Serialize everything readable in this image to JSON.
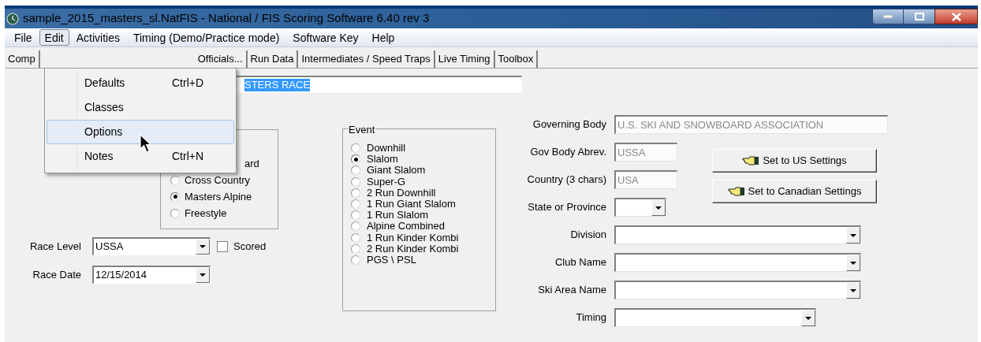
{
  "window": {
    "title": "sample_2015_masters_sl.NatFIS - National / FIS Scoring Software 6.40 rev 3"
  },
  "menu_bar": [
    {
      "label": "File",
      "selected": false
    },
    {
      "label": "Edit",
      "selected": true
    },
    {
      "label": "Activities",
      "selected": false
    },
    {
      "label": "Timing (Demo/Practice mode)",
      "selected": false
    },
    {
      "label": "Software Key",
      "selected": false
    },
    {
      "label": "Help",
      "selected": false
    }
  ],
  "edit_menu": [
    {
      "label": "Defaults",
      "shortcut": "Ctrl+D",
      "selected": false
    },
    {
      "label": "Classes",
      "selected": false
    },
    {
      "label": "Options",
      "selected": true
    },
    {
      "label": "Notes",
      "shortcut": "Ctrl+N",
      "selected": false
    }
  ],
  "tabs": [
    {
      "label": "Comp"
    },
    {
      "label": "Officials..."
    },
    {
      "label": "Run Data"
    },
    {
      "label": "Intermediates / Speed Traps"
    },
    {
      "label": "Live Timing"
    },
    {
      "label": "Toolbox"
    }
  ],
  "race_name": {
    "value": "STERS RACE",
    "text_selected": true
  },
  "discipline_covered_label": "ard",
  "discipline": [
    {
      "label": "Cross Country",
      "selected": false
    },
    {
      "label": "Masters Alpine",
      "selected": true
    },
    {
      "label": "Freestyle",
      "selected": false
    }
  ],
  "race_level": {
    "label": "Race Level",
    "value": "USSA"
  },
  "scored": {
    "label": "Scored",
    "checked": false
  },
  "race_date": {
    "label": "Race Date",
    "value": "12/15/2014"
  },
  "event": {
    "title": "Event",
    "options": [
      {
        "label": "Downhill",
        "selected": false
      },
      {
        "label": "Slalom",
        "selected": true
      },
      {
        "label": "Giant Slalom",
        "selected": false
      },
      {
        "label": "Super-G",
        "selected": false
      },
      {
        "label": "2 Run Downhill",
        "selected": false
      },
      {
        "label": "1 Run Giant Slalom",
        "selected": false
      },
      {
        "label": "1 Run Slalom",
        "selected": false
      },
      {
        "label": "Alpine Combined",
        "selected": false
      },
      {
        "label": "1 Run Kinder Kombi",
        "selected": false
      },
      {
        "label": "2 Run Kinder Kombi",
        "selected": false
      },
      {
        "label": "PGS \\ PSL",
        "selected": false
      }
    ]
  },
  "settings_fields": [
    {
      "label": "Governing Body",
      "kind": "text",
      "value": "U.S. SKI AND SNOWBOARD ASSOCIATION",
      "disabled": true
    },
    {
      "label": "Gov Body Abrev.",
      "kind": "text",
      "value": "USSA",
      "disabled": true
    },
    {
      "label": "Country (3 chars)",
      "kind": "text",
      "value": "USA",
      "disabled": true
    },
    {
      "label": "State or Province",
      "kind": "combo"
    },
    {
      "label": "Division",
      "kind": "combo"
    },
    {
      "label": "Club Name",
      "kind": "combo"
    },
    {
      "label": "Ski Area Name",
      "kind": "combo"
    },
    {
      "label": "Timing",
      "kind": "combo"
    }
  ],
  "buttons": [
    {
      "label": "Set to US Settings"
    },
    {
      "label": "Set to Canadian Settings"
    }
  ]
}
